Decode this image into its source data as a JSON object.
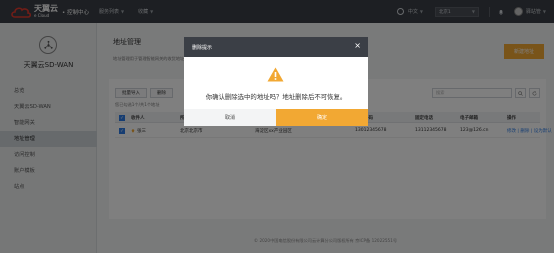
{
  "topbar": {
    "logo_cn": "天翼云",
    "logo_en": "e Cloud",
    "console_title": "• 控制中心",
    "nav": [
      {
        "label": "服务列表"
      },
      {
        "label": "收藏"
      }
    ],
    "language": "中文",
    "region": "北京1",
    "username": "驿站管"
  },
  "sidebar": {
    "title": "天翼云SD-WAN",
    "items": [
      {
        "label": "总览",
        "active": false
      },
      {
        "label": "天翼云SD-WAN",
        "active": false
      },
      {
        "label": "智能网关",
        "active": false
      },
      {
        "label": "地址管理",
        "active": true
      },
      {
        "label": "访问控制",
        "active": false
      },
      {
        "label": "账户模板",
        "active": false
      },
      {
        "label": "站点",
        "active": false
      }
    ]
  },
  "main": {
    "title": "地址管理",
    "description": "地址管理用于管理智能网关的收货地址",
    "new_button": "新建地址",
    "toolbar": {
      "import": "批量导入",
      "delete": "删除"
    },
    "search_placeholder": "搜索",
    "selected_info": "您已勾选1个/共1个地址",
    "columns": [
      "收件人",
      "所在地区",
      "详细地址",
      "邮政编码",
      "手机号码",
      "固定电话",
      "电子邮箱",
      "操作"
    ],
    "rows": [
      {
        "recipient": "张三",
        "region": "北京北京市",
        "address": "海淀区xx产业园区",
        "postcode": "",
        "mobile": "13012345678",
        "phone": "13112345678",
        "email": "123@126.cn",
        "actions": "修改 | 删除 | 设为默认"
      }
    ]
  },
  "modal": {
    "title": "删除提示",
    "message": "你确认删除选中的地址吗？地址删除后不可恢复。",
    "cancel": "取消",
    "confirm": "确定"
  },
  "footer": "© 2020中国电信股份有限公司云计算分公司版权所有 京ICP备 12022551号",
  "colors": {
    "accent": "#f2a833",
    "topbar": "#3b3f46",
    "link": "#2c7be5"
  }
}
